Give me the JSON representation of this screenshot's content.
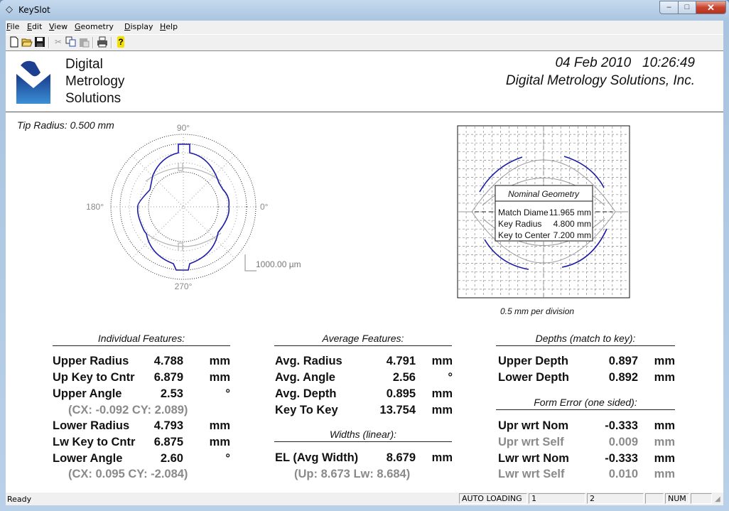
{
  "window": {
    "title": "KeySlot",
    "icon": "diamond-app-icon",
    "controls": {
      "minimize": "–",
      "maximize": "□",
      "close": "✕"
    }
  },
  "menu": {
    "items": [
      {
        "label": "File",
        "accel": "F",
        "rest": "ile"
      },
      {
        "label": "Edit",
        "accel": "E",
        "rest": "dit"
      },
      {
        "label": "View",
        "accel": "V",
        "rest": "iew"
      },
      {
        "label": "Geometry",
        "accel": "G",
        "rest": "eometry"
      },
      {
        "label": "Display",
        "accel": "D",
        "rest": "isplay"
      },
      {
        "label": "Help",
        "accel": "H",
        "rest": "elp"
      }
    ]
  },
  "toolbar": {
    "buttons": [
      {
        "name": "new-file-icon",
        "glyph": "🗋",
        "enabled": true
      },
      {
        "name": "open-folder-icon",
        "glyph": "📂",
        "enabled": true
      },
      {
        "name": "save-icon",
        "glyph": "💾",
        "enabled": true
      },
      {
        "name": "cut-icon",
        "glyph": "✂",
        "enabled": false
      },
      {
        "name": "copy-icon",
        "glyph": "⧉",
        "enabled": true
      },
      {
        "name": "paste-icon",
        "glyph": "📋",
        "enabled": false
      },
      {
        "name": "print-icon",
        "glyph": "🖶",
        "enabled": true
      },
      {
        "name": "help-icon",
        "glyph": "?",
        "enabled": true
      }
    ]
  },
  "header": {
    "logo_lines": [
      "Digital",
      "Metrology",
      "Solutions"
    ],
    "date": "04 Feb 2010",
    "time": "10:26:49",
    "company": "Digital Metrology Solutions, Inc."
  },
  "polar_plot": {
    "tip_radius": "Tip Radius: 0.500 mm",
    "angle_labels": {
      "top": "90°",
      "left": "180°",
      "right": "0°",
      "bottom": "270°"
    },
    "scale_label": "1000.00 µm",
    "colors": {
      "profile": "#1a1aa8",
      "nominal": "#b4b4b4",
      "grid": "#222222"
    }
  },
  "nominal_plot": {
    "title": "Nominal Geometry",
    "rows": [
      {
        "label": "Match Diame",
        "value": "11.965 mm"
      },
      {
        "label": "Key Radius",
        "value": "4.800 mm"
      },
      {
        "label": "Key to Center",
        "value": "7.200 mm"
      }
    ],
    "scale_caption": "0.5 mm per division"
  },
  "individual": {
    "title": "Individual Features:",
    "rows": [
      {
        "label": "Upper Radius",
        "value": "4.788",
        "unit": "mm"
      },
      {
        "label": "Up Key to Cntr",
        "value": "6.879",
        "unit": "mm"
      },
      {
        "label": "Upper Angle",
        "value": "2.53",
        "unit": "°"
      },
      {
        "label": "Lower Radius",
        "value": "4.793",
        "unit": "mm"
      },
      {
        "label": "Lw Key to Cntr",
        "value": "6.875",
        "unit": "mm"
      },
      {
        "label": "Lower Angle",
        "value": "2.60",
        "unit": "°"
      }
    ],
    "upper_center": "(CX: -0.092   CY: 2.089)",
    "lower_center": "(CX: 0.095   CY: -2.084)"
  },
  "average": {
    "title": "Average Features:",
    "rows": [
      {
        "label": "Avg. Radius",
        "value": "4.791",
        "unit": "mm"
      },
      {
        "label": "Avg. Angle",
        "value": "2.56",
        "unit": "°"
      },
      {
        "label": "Avg. Depth",
        "value": "0.895",
        "unit": "mm"
      },
      {
        "label": "Key To Key",
        "value": "13.754",
        "unit": "mm"
      }
    ],
    "widths_title": "Widths (linear):",
    "width_row": {
      "label": "EL (Avg Width)",
      "value": "8.679",
      "unit": "mm"
    },
    "width_sub": "(Up: 8.673   Lw: 8.684)"
  },
  "depths": {
    "title": "Depths (match to key):",
    "rows": [
      {
        "label": "Upper Depth",
        "value": "0.897",
        "unit": "mm"
      },
      {
        "label": "Lower Depth",
        "value": "0.892",
        "unit": "mm"
      }
    ],
    "form_title": "Form Error (one sided):",
    "form_rows": [
      {
        "label": "Upr wrt Nom",
        "value": "-0.333",
        "unit": "mm",
        "grey": false
      },
      {
        "label": "Upr wrt Self",
        "value": "0.009",
        "unit": "mm",
        "grey": true
      },
      {
        "label": "Lwr wrt Nom",
        "value": "-0.333",
        "unit": "mm",
        "grey": false
      },
      {
        "label": "Lwr wrt Self",
        "value": "0.010",
        "unit": "mm",
        "grey": true
      }
    ]
  },
  "statusbar": {
    "ready": "Ready",
    "panes": [
      "AUTO LOADING",
      "1",
      "2",
      "",
      "NUM",
      ""
    ]
  }
}
